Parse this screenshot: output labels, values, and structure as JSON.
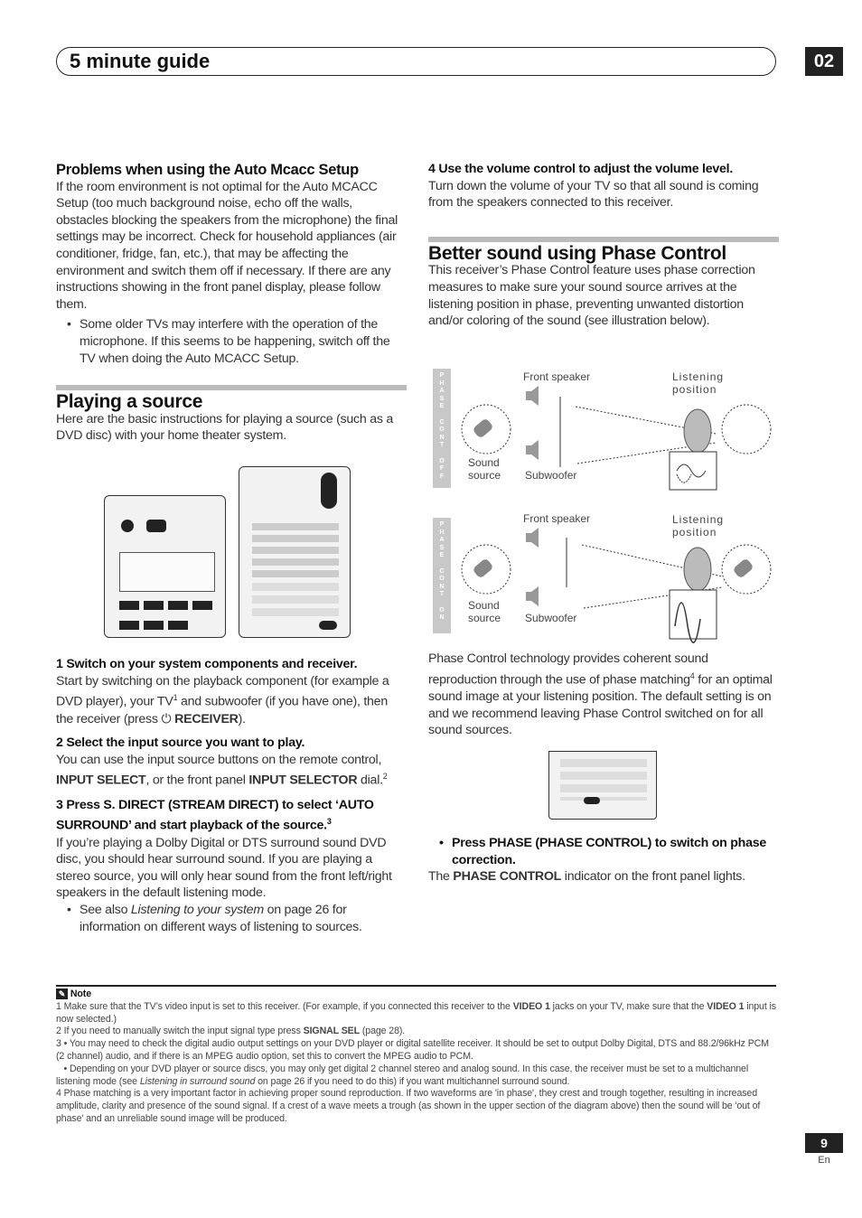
{
  "header": {
    "title": "5 minute guide",
    "chapter": "02"
  },
  "left": {
    "problems_heading": "Problems when using the Auto Mcacc Setup",
    "problems_text": "If the room environment is not optimal for the Auto MCACC Setup (too much background noise, echo off the walls, obstacles blocking the speakers from the microphone) the final settings may be incorrect. Check for household appliances (air conditioner, fridge, fan, etc.), that may be affecting the environment and switch them off if necessary. If there are any instructions showing in the front panel display, please follow them.",
    "problems_bullet": "Some older TVs may interfere with the operation of the microphone. If this seems to be happening, switch off the TV when doing the Auto MCACC Setup.",
    "playing_heading": "Playing a source",
    "playing_intro": "Here are the basic instructions for playing a source (such as a DVD disc) with your home theater system.",
    "step1_title": "1    Switch on your system components and receiver.",
    "step1_a": "Start by switching on the playback component (for example a DVD player), your TV",
    "step1_sup": "1",
    "step1_b": " and subwoofer (if you have one), then the receiver (press ",
    "step1_power": "⏻",
    "step1_bold": "RECEIVER",
    "step1_c": ").",
    "step2_title": "2    Select the input source you want to play.",
    "step2_a": "You can use the input source buttons on the remote control, ",
    "step2_b1": "INPUT SELECT",
    "step2_c": ", or the front panel ",
    "step2_b2": "INPUT SELECTOR",
    "step2_d": " dial.",
    "step2_sup": "2",
    "step3_title": "3    Press S. DIRECT (STREAM DIRECT) to select ‘AUTO SURROUND’ and start playback of the source.",
    "step3_sup": "3",
    "step3_text": "If you’re playing a Dolby Digital or DTS surround sound DVD disc, you should hear surround sound. If you are playing a stereo source, you will only hear sound from the front left/right speakers in the default listening mode.",
    "step3_bullet_a": "See also ",
    "step3_bullet_i": "Listening to your system",
    "step3_bullet_b": " on page 26 for information on different ways of listening to sources."
  },
  "right": {
    "step4_title": "4    Use the volume control to adjust the volume level.",
    "step4_text": "Turn down the volume of your TV so that all sound is coming from the speakers connected to this receiver.",
    "phase_heading": "Better sound using Phase Control",
    "phase_intro": "This receiver’s Phase Control feature uses phase correction measures to make sure your sound source arrives at the listening position in phase, preventing unwanted distortion and/or coloring of the sound (see illustration below).",
    "diagram": {
      "off_tag": [
        "P",
        "H",
        "A",
        "S",
        "E",
        " ",
        "C",
        "O",
        "N",
        "T",
        " ",
        "O",
        "F",
        "F"
      ],
      "on_tag": [
        "P",
        "H",
        "A",
        "S",
        "E",
        " ",
        "C",
        "O",
        "N",
        "T",
        " ",
        "O",
        "N"
      ],
      "front_speaker": "Front speaker",
      "subwoofer": "Subwoofer",
      "sound_source": "Sound source",
      "listening_position": "Listening position"
    },
    "phase_tech_a": "Phase Control technology provides coherent sound reproduction through the use of phase matching",
    "phase_tech_sup": "4",
    "phase_tech_b": " for an optimal sound image at your listening position. The default setting is on and we recommend leaving Phase Control switched on for all sound sources.",
    "press_a": "Press PHASE (",
    "press_b": "PHASE CONTROL",
    "press_c": ") to switch on phase correction.",
    "press_text_a": "The ",
    "press_text_b": "PHASE CONTROL",
    "press_text_c": " indicator on the front panel lights."
  },
  "note": {
    "label": "Note",
    "n1_a": "1 Make sure that the TV’s video input is set to this receiver. (For example, if you connected this receiver to the ",
    "n1_b": "VIDEO 1",
    "n1_c": " jacks on your TV, make sure that the ",
    "n1_d": "VIDEO 1",
    "n1_e": " input is now selected.)",
    "n2_a": "2 If you need to manually switch the input signal type press ",
    "n2_b": "SIGNAL SEL",
    "n2_c": " (page 28).",
    "n3_a": "3 • You may need to check the digital audio output settings on your DVD player or digital satellite receiver. It should be set to output Dolby Digital, DTS and 88.2/96kHz PCM (2 channel) audio, and if there is an MPEG audio option, set this to convert the MPEG audio to PCM.",
    "n3_b1": "   • Depending on your DVD player or source discs, you may only get digital 2 channel stereo and analog sound. In this case, the receiver must be set to a multichannel listening mode (see ",
    "n3_b2": "Listening in surround sound",
    "n3_b3": " on page 26 if you need to do this) if you want multichannel surround sound.",
    "n4": "4 Phase matching is a very important factor in achieving proper sound reproduction. If two waveforms are 'in phase', they crest and trough together, resulting in increased amplitude, clarity and presence of the sound signal. If a crest of a wave meets a trough (as shown in the upper section of the diagram above) then the sound will be 'out of phase' and an unreliable sound image will be produced."
  },
  "footer": {
    "page": "9",
    "lang": "En"
  }
}
